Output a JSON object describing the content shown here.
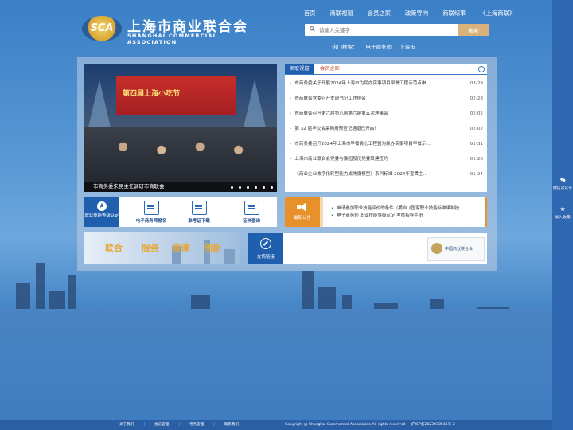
{
  "header": {
    "logo_abbr": "SCA",
    "logo_cn": "上海市商业联合会",
    "logo_en": "SHANGHAI COMMERCIAL ASSOCIATION",
    "nav": [
      "首页",
      "商联视窗",
      "会员之家",
      "政策导向",
      "商联纪事",
      "《上海商联》"
    ],
    "search_placeholder": "请输入关键字",
    "search_button": "搜索",
    "hot_label": "热门搜索：",
    "hot_items": [
      "电子商务师",
      "上海市"
    ]
  },
  "slider": {
    "stage_text": "第四届上海小吃节",
    "caption": "市商务委朱民主任调研市商联会",
    "dots": 6
  },
  "news": {
    "tabs": [
      "商联视窗",
      "会员之家"
    ],
    "items": [
      {
        "title": "市商务委关于开展2024年上海市为民办实事项目早餐工程示范点申...",
        "date": "03-29"
      },
      {
        "title": "市商联会党委召开支部书记工作例会",
        "date": "02-28"
      },
      {
        "title": "市商联会召开第六届第八届第六届第五次理事会",
        "date": "02-02"
      },
      {
        "title": "第 32 届华交会采购商预登记通道已开启！",
        "date": "02-02"
      },
      {
        "title": "市商务委召开2024年上海市早餐民心工程暨为民办实事项目早餐示...",
        "date": "01-31"
      },
      {
        "title": "上海市商业联合会党委与豫园股份党委联建签约",
        "date": "01-26"
      },
      {
        "title": "《商业企业数字化转型能力成熟度模型》系列标准 2024年宣贯主...",
        "date": "01-24"
      }
    ]
  },
  "services": {
    "main_label": "职业技能等级认定",
    "items": [
      "电子商务师报名",
      "准考证下载",
      "证书查询"
    ]
  },
  "notice": {
    "label": "最新公告",
    "items": [
      "申请参加职业技能评价的条件（摘自《国家职业技能标准编制技...",
      "电子商务师 职业技能等级认定 考核指导手册"
    ]
  },
  "banner": {
    "words": [
      "联合",
      "服务",
      "自律",
      "创新"
    ]
  },
  "friend_links": {
    "label": "友情链接",
    "logo_text": "中国商业联合会"
  },
  "float": {
    "wechat": "微信公众号",
    "favorite": "加入收藏"
  },
  "footer": {
    "links": [
      "关于我们",
      "会员管理",
      "考务管理",
      "联系我们"
    ],
    "copyright": "Copyright @ Shanghai Commercial Association.All rights reserved",
    "icp": "沪ICP备2023038545号-2"
  },
  "colors": {
    "brand_blue": "#1f5fae",
    "accent_orange": "#e8902a",
    "search_button": "#d8b27a"
  }
}
